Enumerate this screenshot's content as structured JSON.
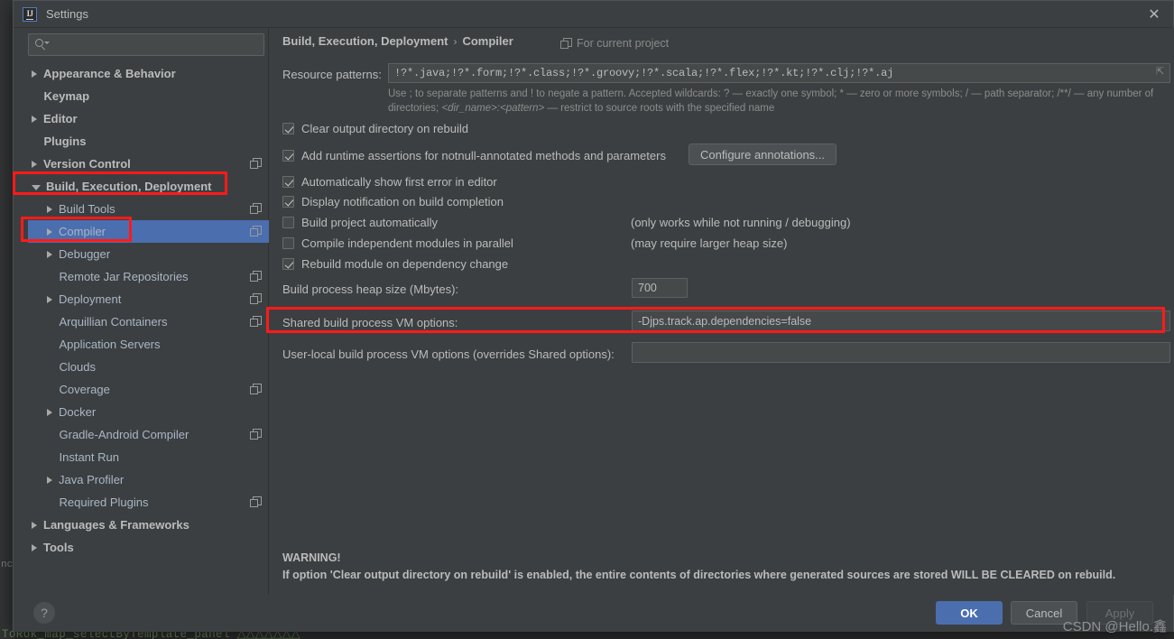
{
  "window": {
    "title": "Settings",
    "app_icon": "IJ",
    "close_icon": "✕"
  },
  "sidebar": {
    "search_placeholder": "",
    "search_icon": "search-icon",
    "items": [
      {
        "label": "Appearance & Behavior",
        "depth": 0,
        "arrow": "right",
        "bold": true,
        "copy": false,
        "selected": false
      },
      {
        "label": "Keymap",
        "depth": 0,
        "arrow": "none",
        "bold": true,
        "copy": false,
        "selected": false
      },
      {
        "label": "Editor",
        "depth": 0,
        "arrow": "right",
        "bold": true,
        "copy": false,
        "selected": false
      },
      {
        "label": "Plugins",
        "depth": 0,
        "arrow": "none",
        "bold": true,
        "copy": false,
        "selected": false
      },
      {
        "label": "Version Control",
        "depth": 0,
        "arrow": "right",
        "bold": true,
        "copy": true,
        "selected": false
      },
      {
        "label": "Build, Execution, Deployment",
        "depth": 0,
        "arrow": "down",
        "bold": true,
        "copy": false,
        "selected": false
      },
      {
        "label": "Build Tools",
        "depth": 1,
        "arrow": "right",
        "bold": false,
        "copy": true,
        "selected": false
      },
      {
        "label": "Compiler",
        "depth": 1,
        "arrow": "right",
        "bold": false,
        "copy": true,
        "selected": true
      },
      {
        "label": "Debugger",
        "depth": 1,
        "arrow": "right",
        "bold": false,
        "copy": false,
        "selected": false
      },
      {
        "label": "Remote Jar Repositories",
        "depth": 1,
        "arrow": "none",
        "bold": false,
        "copy": true,
        "selected": false
      },
      {
        "label": "Deployment",
        "depth": 1,
        "arrow": "right",
        "bold": false,
        "copy": true,
        "selected": false
      },
      {
        "label": "Arquillian Containers",
        "depth": 1,
        "arrow": "none",
        "bold": false,
        "copy": true,
        "selected": false
      },
      {
        "label": "Application Servers",
        "depth": 1,
        "arrow": "none",
        "bold": false,
        "copy": false,
        "selected": false
      },
      {
        "label": "Clouds",
        "depth": 1,
        "arrow": "none",
        "bold": false,
        "copy": false,
        "selected": false
      },
      {
        "label": "Coverage",
        "depth": 1,
        "arrow": "none",
        "bold": false,
        "copy": true,
        "selected": false
      },
      {
        "label": "Docker",
        "depth": 1,
        "arrow": "right",
        "bold": false,
        "copy": false,
        "selected": false
      },
      {
        "label": "Gradle-Android Compiler",
        "depth": 1,
        "arrow": "none",
        "bold": false,
        "copy": true,
        "selected": false
      },
      {
        "label": "Instant Run",
        "depth": 1,
        "arrow": "none",
        "bold": false,
        "copy": false,
        "selected": false
      },
      {
        "label": "Java Profiler",
        "depth": 1,
        "arrow": "right",
        "bold": false,
        "copy": false,
        "selected": false
      },
      {
        "label": "Required Plugins",
        "depth": 1,
        "arrow": "none",
        "bold": false,
        "copy": true,
        "selected": false
      },
      {
        "label": "Languages & Frameworks",
        "depth": 0,
        "arrow": "right",
        "bold": true,
        "copy": false,
        "selected": false
      },
      {
        "label": "Tools",
        "depth": 0,
        "arrow": "right",
        "bold": true,
        "copy": false,
        "selected": false
      }
    ]
  },
  "main": {
    "breadcrumb_root": "Build, Execution, Deployment",
    "breadcrumb_sep": "›",
    "breadcrumb_leaf": "Compiler",
    "for_current_project": "For current project",
    "resource_patterns_label": "Resource patterns:",
    "resource_patterns_value": "!?*.java;!?*.form;!?*.class;!?*.groovy;!?*.scala;!?*.flex;!?*.kt;!?*.clj;!?*.aj",
    "resource_patterns_help_line1": "Use ; to separate patterns and ! to negate a pattern. Accepted wildcards: ? — exactly one symbol; * — zero or more symbols; / — path separator; /**/ — any",
    "resource_patterns_help_line2_pre": "number of directories; ",
    "resource_patterns_help_line2_italic": "<dir_name>:<pattern>",
    "resource_patterns_help_line2_post": " — restrict to source roots with the specified name",
    "checkboxes": [
      {
        "label": "Clear output directory on rebuild",
        "checked": true
      },
      {
        "label": "Add runtime assertions for notnull-annotated methods and parameters",
        "checked": true
      },
      {
        "label": "Automatically show first error in editor",
        "checked": true
      },
      {
        "label": "Display notification on build completion",
        "checked": true
      },
      {
        "label": "Build project automatically",
        "checked": false
      },
      {
        "label": "Compile independent modules in parallel",
        "checked": false
      },
      {
        "label": "Rebuild module on dependency change",
        "checked": true
      }
    ],
    "configure_annotations_button": "Configure annotations...",
    "note_build_auto": "(only works while not running / debugging)",
    "note_parallel": "(may require larger heap size)",
    "heap_label": "Build process heap size (Mbytes):",
    "heap_value": "700",
    "shared_vm_label": "Shared build process VM options:",
    "shared_vm_value": "-Djps.track.ap.dependencies=false",
    "user_vm_label": "User-local build process VM options (overrides Shared options):",
    "user_vm_value": "",
    "warning_title": "WARNING!",
    "warning_body": "If option 'Clear output directory on rebuild' is enabled, the entire contents of directories where generated sources are stored WILL BE CLEARED on rebuild."
  },
  "footer": {
    "help_label": "?",
    "ok_label": "OK",
    "cancel_label": "Cancel",
    "apply_label": "Apply"
  },
  "background": {
    "editor_text": "ToRok_map_selectByTemplate_panel △△△△△△△",
    "gutter_text": "nc"
  },
  "watermark": "CSDN @Hello.鑫",
  "colors": {
    "dialog_bg": "#3c3f41",
    "field_bg": "#45494a",
    "selection_blue": "#4b6eaf",
    "annotation_red": "#ff1a1a",
    "text_primary": "#bbbbbb",
    "text_tree": "#a9b7c6",
    "text_muted": "#8a8a8a"
  }
}
